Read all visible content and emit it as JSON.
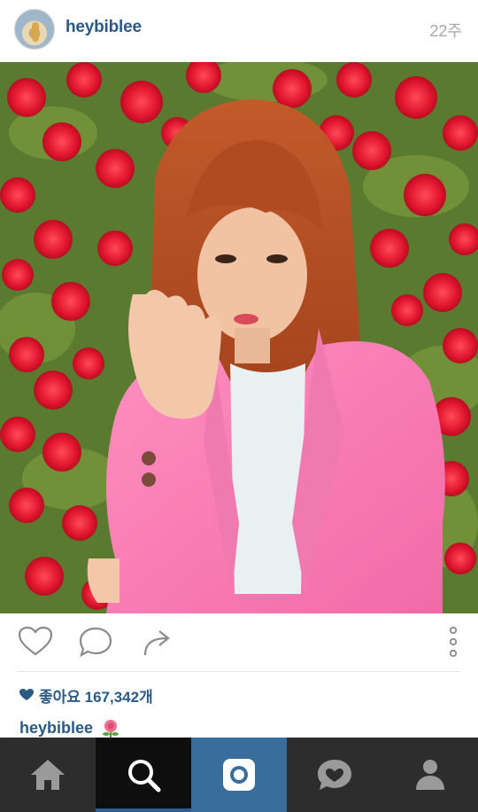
{
  "post": {
    "username": "heybiblee",
    "timestamp": "22주",
    "likes_text": "좋아요 167,342개",
    "caption_user": "heybiblee"
  },
  "icons": {
    "like": "heart-outline-icon",
    "comment": "speech-bubble-icon",
    "share": "share-arrow-icon",
    "more": "vertical-dots-icon",
    "caption_emoji": "rose-icon"
  },
  "tabbar": {
    "tabs": [
      "home-icon",
      "search-icon",
      "camera-icon",
      "activity-icon",
      "profile-icon"
    ],
    "active": "search-icon"
  },
  "colors": {
    "username": "#2a5a84",
    "timestamp": "#a6a6a6",
    "tabbar_bg": "#2d2d2d",
    "camera_tab_bg": "#3a6d9c",
    "active_tab_bg": "#0e0e0e"
  }
}
